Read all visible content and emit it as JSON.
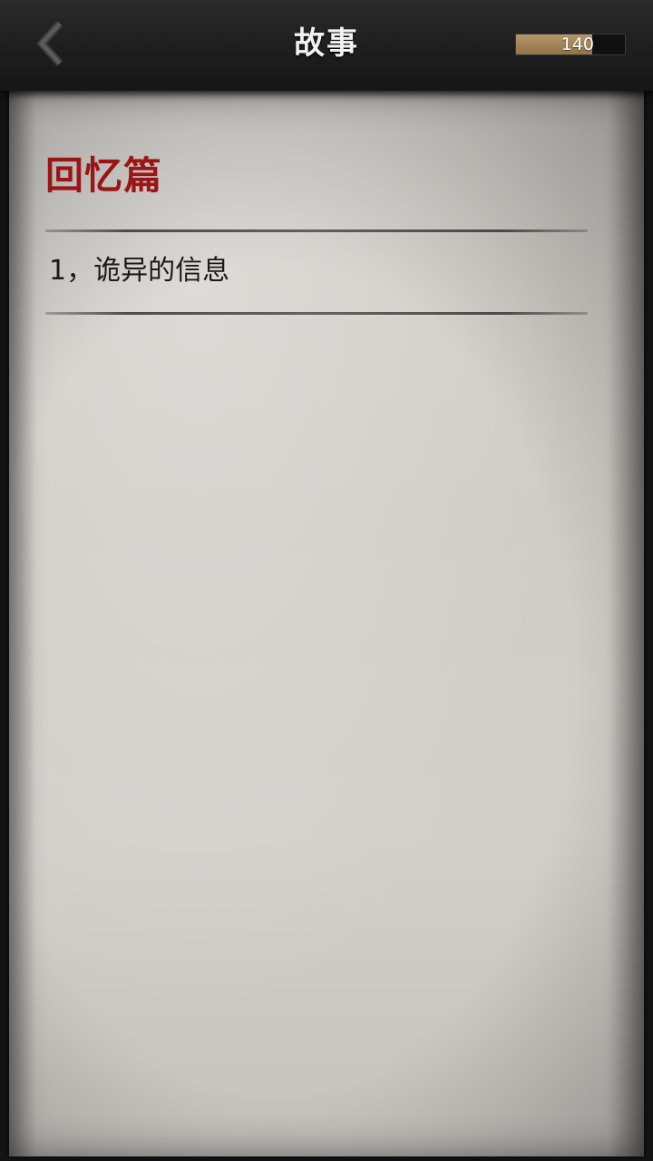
{
  "header": {
    "title": "故事",
    "back_icon": "chevron-left-icon",
    "meter": {
      "value_text": "140",
      "fill_fraction": 0.7,
      "fill_color": "#a88a5a"
    }
  },
  "story": {
    "section_title": "回忆篇",
    "section_title_color": "#9b1516",
    "chapters": [
      {
        "label": "1，诡异的信息"
      }
    ]
  }
}
